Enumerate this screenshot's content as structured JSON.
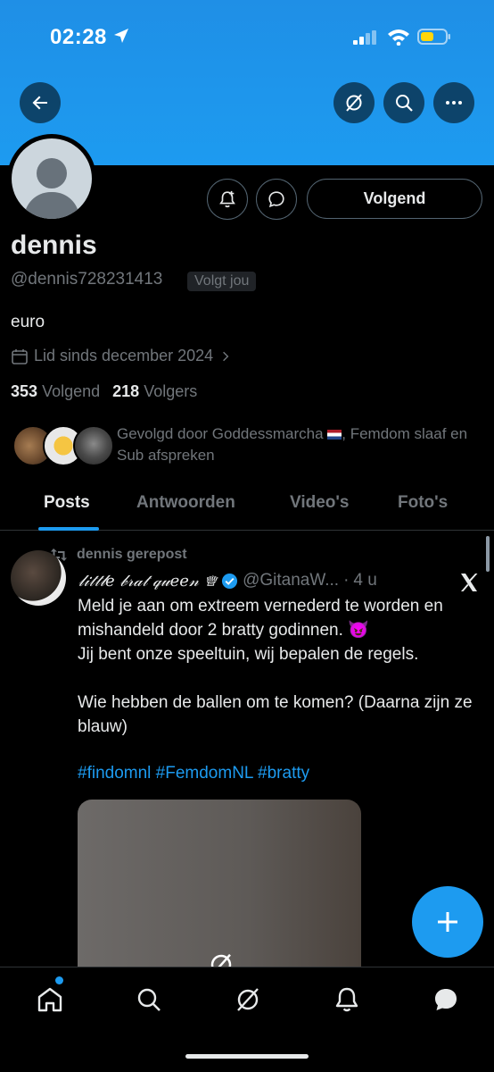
{
  "status_bar": {
    "time": "02:28"
  },
  "colors": {
    "accent": "#1d9bf0",
    "background": "#000000",
    "muted": "#71767b",
    "text": "#e7e9ea"
  },
  "header_actions": {
    "back": "arrow-left-icon",
    "grok": "grok-icon",
    "search": "search-icon",
    "more": "more-icon"
  },
  "profile": {
    "display_name": "dennis",
    "handle": "@dennis728231413",
    "follows_you": "Volgt jou",
    "bio": "euro",
    "joined": "Lid sinds december 2024",
    "following_count": "353",
    "following_label": "Volgend",
    "followers_count": "218",
    "followers_label": "Volgers",
    "follow_button": "Volgend",
    "followed_by_prefix": "Gevolgd door Goddessmarcha",
    "followed_by_suffix": ", Femdom slaaf en Sub afspreken"
  },
  "tabs": [
    {
      "label": "Posts",
      "active": true
    },
    {
      "label": "Antwoorden",
      "active": false
    },
    {
      "label": "Video's",
      "active": false
    },
    {
      "label": "Foto's",
      "active": false
    }
  ],
  "post": {
    "repost_label": "dennis gerepost",
    "author": "𝓁𝒾𝓉𝓉𝓁𝑒 𝒷𝓇𝒶𝓉 𝓆𝓊𝑒𝑒𝓃 ♕",
    "handle": "@GitanaW...",
    "separator": "·",
    "time": "4 u",
    "text": "Meld je aan om extreem vernederd te worden en mishandeld door 2 bratty godinnen. 😈\nJij bent onze speeltuin, wij bepalen de regels.\n\nWie hebben de ballen om te komen? (Daarna zijn ze blauw)",
    "hashtags": "#findomnl #FemdomNL #bratty"
  },
  "bottom_nav": [
    "home-icon",
    "search-icon",
    "grok-icon",
    "notifications-icon",
    "messages-icon"
  ]
}
